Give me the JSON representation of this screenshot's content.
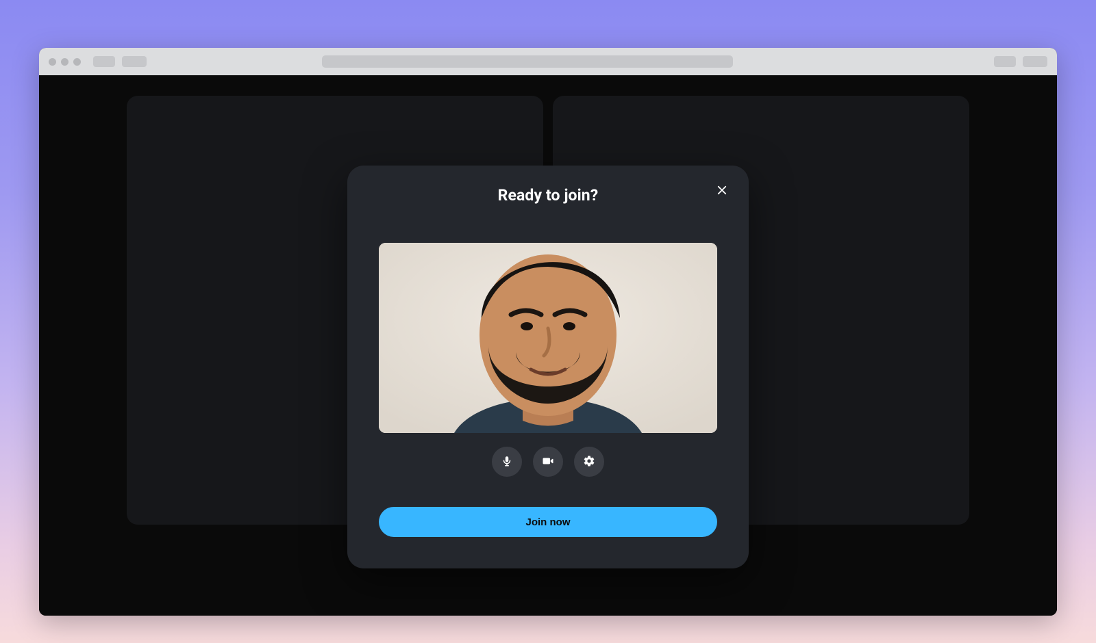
{
  "modal": {
    "title": "Ready to join?",
    "join_label": "Join now",
    "controls": {
      "mic": "microphone-icon",
      "cam": "camera-icon",
      "settings": "gear-icon"
    }
  },
  "colors": {
    "accent": "#38b6ff",
    "modal_bg": "#24272d",
    "tile_bg": "#16171a"
  }
}
